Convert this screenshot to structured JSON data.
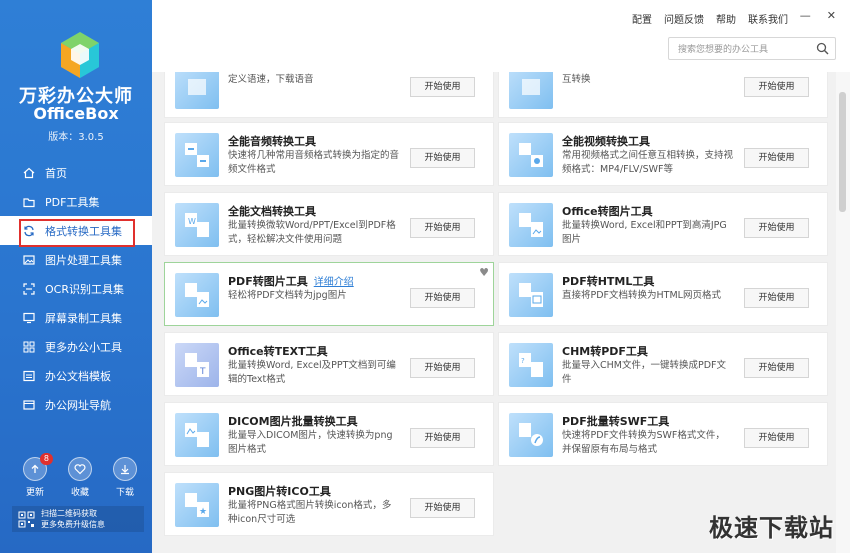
{
  "app": {
    "name_cn": "万彩办公大师",
    "name_en": "OfficeBox",
    "version": "版本：3.0.5"
  },
  "top": {
    "links": [
      "配置",
      "问题反馈",
      "帮助",
      "联系我们"
    ],
    "search_placeholder": "搜索您想要的办公工具"
  },
  "sidebar": {
    "items": [
      {
        "label": "首页",
        "icon": "home-icon"
      },
      {
        "label": "PDF工具集",
        "icon": "folder-icon"
      },
      {
        "label": "格式转换工具集",
        "icon": "convert-icon",
        "active": true
      },
      {
        "label": "图片处理工具集",
        "icon": "image-icon"
      },
      {
        "label": "OCR识别工具集",
        "icon": "ocr-icon"
      },
      {
        "label": "屏幕录制工具集",
        "icon": "screen-icon"
      },
      {
        "label": "更多办公小工具",
        "icon": "grid-icon"
      },
      {
        "label": "办公文档模板",
        "icon": "doc-icon"
      },
      {
        "label": "办公网址导航",
        "icon": "link-icon"
      }
    ],
    "actions": {
      "update": {
        "label": "更新",
        "badge": "8"
      },
      "favorite": {
        "label": "收藏"
      },
      "download": {
        "label": "下载"
      }
    },
    "qr_line1": "扫描二维码获取",
    "qr_line2": "更多免费升级信息"
  },
  "cards": {
    "start_label": "开始使用",
    "detail_link": "详细介绍",
    "items": [
      {
        "title": "",
        "desc": "轻松输入文字便可快速转为语音，还可自定义语速，下载语音"
      },
      {
        "title": "",
        "desc": "批量转换图片格式，轻松实现图片格式相互转换"
      },
      {
        "title": "全能音频转换工具",
        "desc": "快速将几种常用音频格式转换为指定的音频文件格式"
      },
      {
        "title": "全能视频转换工具",
        "desc": "常用视频格式之间任意互相转换，支持视频格式：MP4/FLV/SWF等"
      },
      {
        "title": "全能文档转换工具",
        "desc": "批量转换微软Word/PPT/Excel到PDF格式，轻松解决文件使用问题"
      },
      {
        "title": "Office转图片工具",
        "desc": "批量转换Word, Excel和PPT到高清JPG图片"
      },
      {
        "title": "PDF转图片工具",
        "desc": "轻松将PDF文档转为jpg图片",
        "highlight": true
      },
      {
        "title": "PDF转HTML工具",
        "desc": "直接将PDF文档转换为HTML网页格式"
      },
      {
        "title": "Office转TEXT工具",
        "desc": "批量转换Word, Excel及PPT文档到可编辑的Text格式"
      },
      {
        "title": "CHM转PDF工具",
        "desc": "批量导入CHM文件，一键转换成PDF文件"
      },
      {
        "title": "DICOM图片批量转换工具",
        "desc": "批量导入DICOM图片，快速转换为png图片格式"
      },
      {
        "title": "PDF批量转SWF工具",
        "desc": "快速将PDF文件转换为SWF格式文件，并保留原有布局与格式"
      },
      {
        "title": "PNG图片转ICO工具",
        "desc": "批量将PNG格式图片转换icon格式，多种icon尺寸可选"
      }
    ]
  },
  "watermark": "极速下载站"
}
